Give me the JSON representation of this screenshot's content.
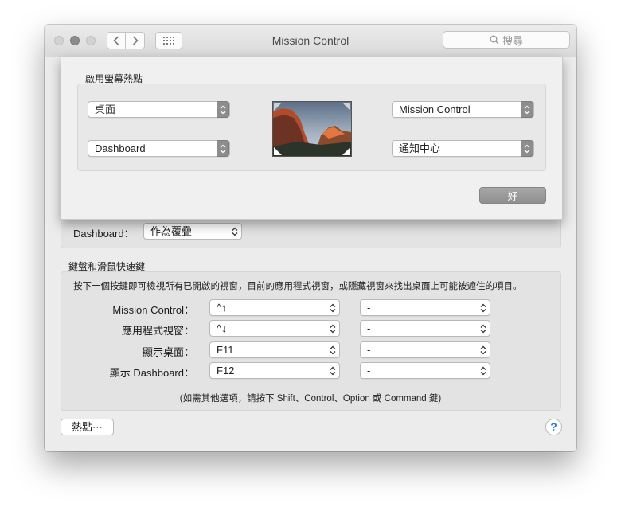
{
  "window": {
    "title": "Mission Control",
    "search_placeholder": "搜尋"
  },
  "hot_corners_sheet": {
    "heading": "啟用螢幕熱點",
    "top_left": "桌面",
    "bottom_left": "Dashboard",
    "top_right": "Mission Control",
    "bottom_right": "通知中心",
    "ok_label": "好"
  },
  "dashboard": {
    "label": "Dashboard：",
    "value": "作為覆疊"
  },
  "keyboard": {
    "heading": "鍵盤和滑鼠快速鍵",
    "description": "按下一個按鍵即可檢視所有已開啟的視窗，目前的應用程式視窗，或隱藏視窗來找出桌面上可能被遮住的項目。",
    "rows": [
      {
        "label": "Mission Control：",
        "key": "^↑",
        "mouse": "-"
      },
      {
        "label": "應用程式視窗：",
        "key": "^↓",
        "mouse": "-"
      },
      {
        "label": "顯示桌面：",
        "key": "F11",
        "mouse": "-"
      },
      {
        "label": "顯示 Dashboard：",
        "key": "F12",
        "mouse": "-"
      }
    ],
    "footnote": "(如需其他選項，請按下 Shift、Control、Option 或 Command 鍵)"
  },
  "footer": {
    "hot_corners_button": "熱點⋯",
    "help_label": "?"
  },
  "colors": {
    "help_accent": "#2f7be0",
    "ok_button": "#9a9a9a"
  }
}
